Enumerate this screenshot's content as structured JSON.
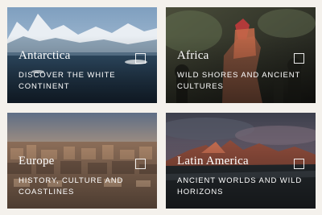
{
  "cards": [
    {
      "title": "Antarctica",
      "subtitle": "DISCOVER THE WHITE CONTINENT"
    },
    {
      "title": "Africa",
      "subtitle": "WILD SHORES AND ANCIENT CULTURES"
    },
    {
      "title": "Europe",
      "subtitle": "HISTORY, CULTURE AND COASTLINES"
    },
    {
      "title": "Latin America",
      "subtitle": "ANCIENT WORLDS AND WILD HORIZONS"
    }
  ]
}
